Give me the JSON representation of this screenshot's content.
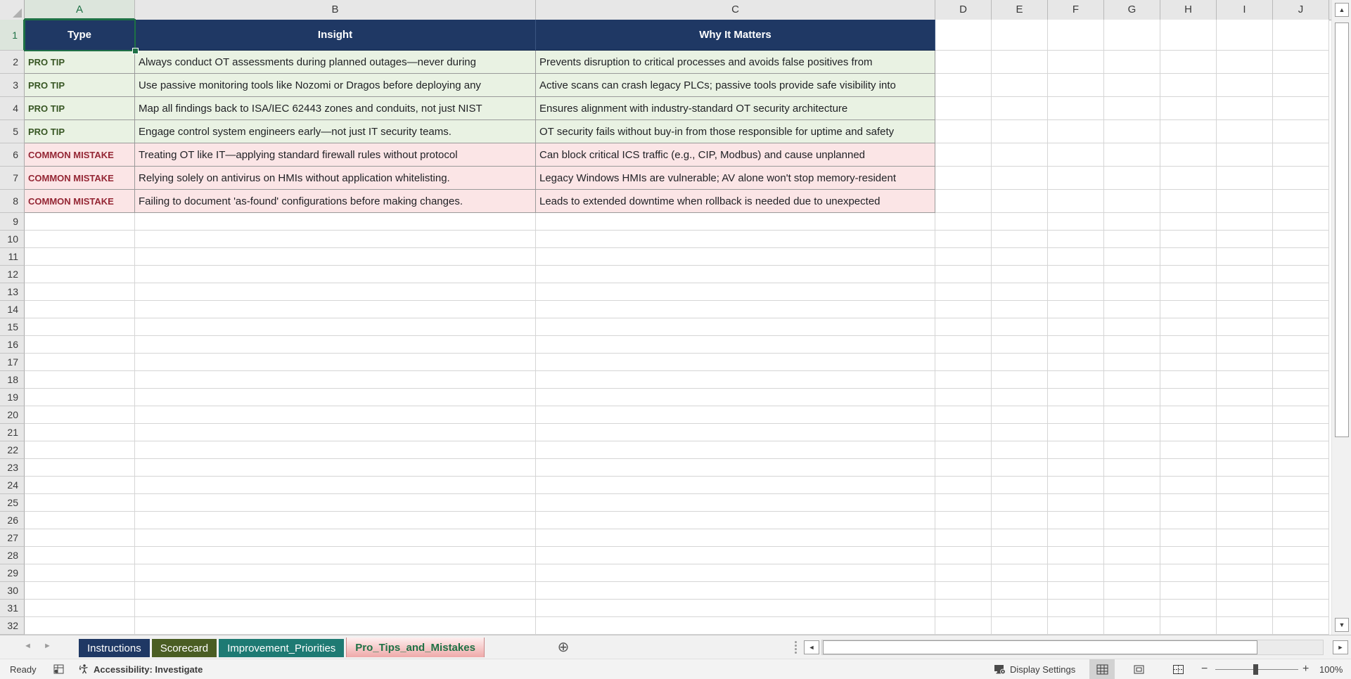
{
  "grid": {
    "column_letters": [
      "A",
      "B",
      "C",
      "D",
      "E",
      "F",
      "G",
      "H",
      "I",
      "J"
    ],
    "visible_row_count": 32
  },
  "selection": {
    "active_cell": "A1",
    "selected_column": "A",
    "selected_row": "1"
  },
  "table": {
    "headers": [
      "Type",
      "Insight",
      "Why It Matters"
    ],
    "rows": [
      {
        "category": "pro_tip",
        "type": "PRO TIP",
        "insight": "Always conduct OT assessments during planned outages—never during",
        "why_it_matters": "Prevents disruption to critical processes and avoids false positives from"
      },
      {
        "category": "pro_tip",
        "type": "PRO TIP",
        "insight": "Use passive monitoring tools like Nozomi or Dragos before deploying any",
        "why_it_matters": "Active scans can crash legacy PLCs; passive tools provide safe visibility into"
      },
      {
        "category": "pro_tip",
        "type": "PRO TIP",
        "insight": "Map all findings back to ISA/IEC 62443 zones and conduits, not just NIST",
        "why_it_matters": "Ensures alignment with industry-standard OT security architecture"
      },
      {
        "category": "pro_tip",
        "type": "PRO TIP",
        "insight": "Engage control system engineers early—not just IT security teams.",
        "why_it_matters": "OT security fails without buy-in from those responsible for uptime and safety"
      },
      {
        "category": "common_mistake",
        "type": "COMMON MISTAKE",
        "insight": "Treating OT like IT—applying standard firewall rules without protocol",
        "why_it_matters": "Can block critical ICS traffic (e.g., CIP, Modbus) and cause unplanned"
      },
      {
        "category": "common_mistake",
        "type": "COMMON MISTAKE",
        "insight": "Relying solely on antivirus on HMIs without application whitelisting.",
        "why_it_matters": "Legacy Windows HMIs are vulnerable; AV alone won't stop memory-resident"
      },
      {
        "category": "common_mistake",
        "type": "COMMON MISTAKE",
        "insight": "Failing to document 'as-found' configurations before making changes.",
        "why_it_matters": "Leads to extended downtime when rollback is needed due to unexpected"
      }
    ]
  },
  "sheet_tabs": {
    "tabs": [
      {
        "label": "Instructions",
        "color": "#1F3864",
        "active": false
      },
      {
        "label": "Scorecard",
        "color": "#4A5D23",
        "active": false
      },
      {
        "label": "Improvement_Priorities",
        "color": "#1E7A73",
        "active": false
      },
      {
        "label": "Pro_Tips_and_Mistakes",
        "color": "#F2B8B8",
        "active": true
      }
    ]
  },
  "status_bar": {
    "ready": "Ready",
    "accessibility": "Accessibility: Investigate",
    "display_settings": "Display Settings",
    "zoom_level": "100%"
  },
  "colors": {
    "header_fill": "#1F3864",
    "header_text": "#FFFFFF",
    "pro_tip_fill": "#E9F2E3",
    "pro_tip_text": "#375623",
    "common_mistake_fill": "#FBE5E6",
    "common_mistake_text": "#942634",
    "selection_green": "#1E7145",
    "active_tab_text": "#1E7145"
  }
}
